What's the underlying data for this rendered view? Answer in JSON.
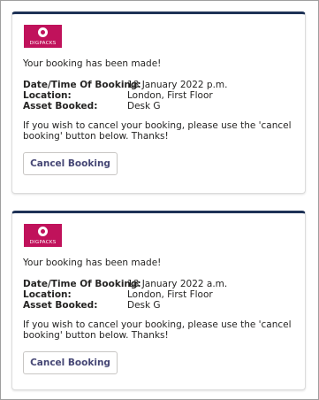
{
  "colors": {
    "accent_bar": "#1e3256",
    "logo_bg": "#c0125b",
    "button_text": "#464775",
    "body_text": "#252423"
  },
  "logo": {
    "text": "DIGPACKS",
    "icon": "circle-logo-icon"
  },
  "cards": [
    {
      "message": "Your booking has been made!",
      "date_label": "Date/Time Of Booking:",
      "date_value": "18 January 2022 p.m.",
      "location_label": "Location:",
      "location_value": "London, First Floor",
      "asset_label": "Asset Booked:",
      "asset_value": "Desk G",
      "note": "If you wish to cancel your booking, please use the 'cancel booking' button below. Thanks!",
      "button_label": "Cancel Booking"
    },
    {
      "message": "Your booking has been made!",
      "date_label": "Date/Time Of Booking:",
      "date_value": "18 January 2022 a.m.",
      "location_label": "Location:",
      "location_value": "London, First Floor",
      "asset_label": "Asset Booked:",
      "asset_value": "Desk G",
      "note": "If you wish to cancel your booking, please use the 'cancel booking' button below. Thanks!",
      "button_label": "Cancel Booking"
    }
  ]
}
